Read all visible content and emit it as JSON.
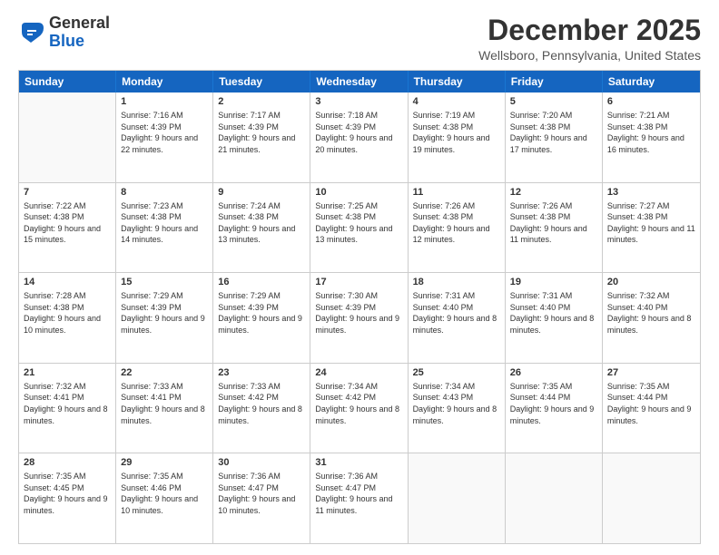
{
  "logo": {
    "general": "General",
    "blue": "Blue"
  },
  "title": "December 2025",
  "location": "Wellsboro, Pennsylvania, United States",
  "header_days": [
    "Sunday",
    "Monday",
    "Tuesday",
    "Wednesday",
    "Thursday",
    "Friday",
    "Saturday"
  ],
  "rows": [
    [
      {
        "day": "",
        "empty": true
      },
      {
        "day": "1",
        "sunrise": "Sunrise: 7:16 AM",
        "sunset": "Sunset: 4:39 PM",
        "daylight": "Daylight: 9 hours and 22 minutes."
      },
      {
        "day": "2",
        "sunrise": "Sunrise: 7:17 AM",
        "sunset": "Sunset: 4:39 PM",
        "daylight": "Daylight: 9 hours and 21 minutes."
      },
      {
        "day": "3",
        "sunrise": "Sunrise: 7:18 AM",
        "sunset": "Sunset: 4:39 PM",
        "daylight": "Daylight: 9 hours and 20 minutes."
      },
      {
        "day": "4",
        "sunrise": "Sunrise: 7:19 AM",
        "sunset": "Sunset: 4:38 PM",
        "daylight": "Daylight: 9 hours and 19 minutes."
      },
      {
        "day": "5",
        "sunrise": "Sunrise: 7:20 AM",
        "sunset": "Sunset: 4:38 PM",
        "daylight": "Daylight: 9 hours and 17 minutes."
      },
      {
        "day": "6",
        "sunrise": "Sunrise: 7:21 AM",
        "sunset": "Sunset: 4:38 PM",
        "daylight": "Daylight: 9 hours and 16 minutes."
      }
    ],
    [
      {
        "day": "7",
        "sunrise": "Sunrise: 7:22 AM",
        "sunset": "Sunset: 4:38 PM",
        "daylight": "Daylight: 9 hours and 15 minutes."
      },
      {
        "day": "8",
        "sunrise": "Sunrise: 7:23 AM",
        "sunset": "Sunset: 4:38 PM",
        "daylight": "Daylight: 9 hours and 14 minutes."
      },
      {
        "day": "9",
        "sunrise": "Sunrise: 7:24 AM",
        "sunset": "Sunset: 4:38 PM",
        "daylight": "Daylight: 9 hours and 13 minutes."
      },
      {
        "day": "10",
        "sunrise": "Sunrise: 7:25 AM",
        "sunset": "Sunset: 4:38 PM",
        "daylight": "Daylight: 9 hours and 13 minutes."
      },
      {
        "day": "11",
        "sunrise": "Sunrise: 7:26 AM",
        "sunset": "Sunset: 4:38 PM",
        "daylight": "Daylight: 9 hours and 12 minutes."
      },
      {
        "day": "12",
        "sunrise": "Sunrise: 7:26 AM",
        "sunset": "Sunset: 4:38 PM",
        "daylight": "Daylight: 9 hours and 11 minutes."
      },
      {
        "day": "13",
        "sunrise": "Sunrise: 7:27 AM",
        "sunset": "Sunset: 4:38 PM",
        "daylight": "Daylight: 9 hours and 11 minutes."
      }
    ],
    [
      {
        "day": "14",
        "sunrise": "Sunrise: 7:28 AM",
        "sunset": "Sunset: 4:38 PM",
        "daylight": "Daylight: 9 hours and 10 minutes."
      },
      {
        "day": "15",
        "sunrise": "Sunrise: 7:29 AM",
        "sunset": "Sunset: 4:39 PM",
        "daylight": "Daylight: 9 hours and 9 minutes."
      },
      {
        "day": "16",
        "sunrise": "Sunrise: 7:29 AM",
        "sunset": "Sunset: 4:39 PM",
        "daylight": "Daylight: 9 hours and 9 minutes."
      },
      {
        "day": "17",
        "sunrise": "Sunrise: 7:30 AM",
        "sunset": "Sunset: 4:39 PM",
        "daylight": "Daylight: 9 hours and 9 minutes."
      },
      {
        "day": "18",
        "sunrise": "Sunrise: 7:31 AM",
        "sunset": "Sunset: 4:40 PM",
        "daylight": "Daylight: 9 hours and 8 minutes."
      },
      {
        "day": "19",
        "sunrise": "Sunrise: 7:31 AM",
        "sunset": "Sunset: 4:40 PM",
        "daylight": "Daylight: 9 hours and 8 minutes."
      },
      {
        "day": "20",
        "sunrise": "Sunrise: 7:32 AM",
        "sunset": "Sunset: 4:40 PM",
        "daylight": "Daylight: 9 hours and 8 minutes."
      }
    ],
    [
      {
        "day": "21",
        "sunrise": "Sunrise: 7:32 AM",
        "sunset": "Sunset: 4:41 PM",
        "daylight": "Daylight: 9 hours and 8 minutes."
      },
      {
        "day": "22",
        "sunrise": "Sunrise: 7:33 AM",
        "sunset": "Sunset: 4:41 PM",
        "daylight": "Daylight: 9 hours and 8 minutes."
      },
      {
        "day": "23",
        "sunrise": "Sunrise: 7:33 AM",
        "sunset": "Sunset: 4:42 PM",
        "daylight": "Daylight: 9 hours and 8 minutes."
      },
      {
        "day": "24",
        "sunrise": "Sunrise: 7:34 AM",
        "sunset": "Sunset: 4:42 PM",
        "daylight": "Daylight: 9 hours and 8 minutes."
      },
      {
        "day": "25",
        "sunrise": "Sunrise: 7:34 AM",
        "sunset": "Sunset: 4:43 PM",
        "daylight": "Daylight: 9 hours and 8 minutes."
      },
      {
        "day": "26",
        "sunrise": "Sunrise: 7:35 AM",
        "sunset": "Sunset: 4:44 PM",
        "daylight": "Daylight: 9 hours and 9 minutes."
      },
      {
        "day": "27",
        "sunrise": "Sunrise: 7:35 AM",
        "sunset": "Sunset: 4:44 PM",
        "daylight": "Daylight: 9 hours and 9 minutes."
      }
    ],
    [
      {
        "day": "28",
        "sunrise": "Sunrise: 7:35 AM",
        "sunset": "Sunset: 4:45 PM",
        "daylight": "Daylight: 9 hours and 9 minutes."
      },
      {
        "day": "29",
        "sunrise": "Sunrise: 7:35 AM",
        "sunset": "Sunset: 4:46 PM",
        "daylight": "Daylight: 9 hours and 10 minutes."
      },
      {
        "day": "30",
        "sunrise": "Sunrise: 7:36 AM",
        "sunset": "Sunset: 4:47 PM",
        "daylight": "Daylight: 9 hours and 10 minutes."
      },
      {
        "day": "31",
        "sunrise": "Sunrise: 7:36 AM",
        "sunset": "Sunset: 4:47 PM",
        "daylight": "Daylight: 9 hours and 11 minutes."
      },
      {
        "day": "",
        "empty": true
      },
      {
        "day": "",
        "empty": true
      },
      {
        "day": "",
        "empty": true
      }
    ]
  ]
}
